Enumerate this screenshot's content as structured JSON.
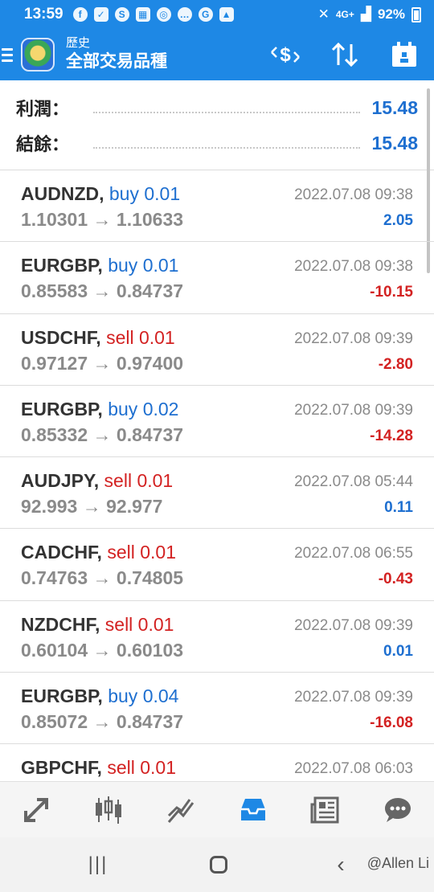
{
  "status_bar": {
    "time": "13:59",
    "icons": [
      "facebook-icon",
      "checkbox-icon",
      "app-icon",
      "calendar-icon",
      "fingerprint-icon",
      "chat-icon",
      "google-icon",
      "gallery-icon"
    ],
    "network": "4G+",
    "battery": "92%"
  },
  "toolbar": {
    "subtitle": "歷史",
    "title": "全部交易品種"
  },
  "summary": {
    "profit_label": "利潤：",
    "profit_value": "15.48",
    "balance_label": "結餘：",
    "balance_value": "15.48"
  },
  "deals": [
    {
      "symbol": "AUDNZD,",
      "direction": "buy 0.01",
      "side": "buy",
      "prices": "1.10301 → 1.10633",
      "datetime": "2022.07.08 09:38",
      "profit": "2.05",
      "profit_sign": "pos"
    },
    {
      "symbol": "EURGBP,",
      "direction": "buy 0.01",
      "side": "buy",
      "prices": "0.85583 → 0.84737",
      "datetime": "2022.07.08 09:38",
      "profit": "-10.15",
      "profit_sign": "neg"
    },
    {
      "symbol": "USDCHF,",
      "direction": "sell 0.01",
      "side": "sell",
      "prices": "0.97127 → 0.97400",
      "datetime": "2022.07.08 09:39",
      "profit": "-2.80",
      "profit_sign": "neg"
    },
    {
      "symbol": "EURGBP,",
      "direction": "buy 0.02",
      "side": "buy",
      "prices": "0.85332 → 0.84737",
      "datetime": "2022.07.08 09:39",
      "profit": "-14.28",
      "profit_sign": "neg"
    },
    {
      "symbol": "AUDJPY,",
      "direction": "sell 0.01",
      "side": "sell",
      "prices": "92.993 → 92.977",
      "datetime": "2022.07.08 05:44",
      "profit": "0.11",
      "profit_sign": "pos"
    },
    {
      "symbol": "CADCHF,",
      "direction": "sell 0.01",
      "side": "sell",
      "prices": "0.74763 → 0.74805",
      "datetime": "2022.07.08 06:55",
      "profit": "-0.43",
      "profit_sign": "neg"
    },
    {
      "symbol": "NZDCHF,",
      "direction": "sell 0.01",
      "side": "sell",
      "prices": "0.60104 → 0.60103",
      "datetime": "2022.07.08 09:39",
      "profit": "0.01",
      "profit_sign": "pos"
    },
    {
      "symbol": "EURGBP,",
      "direction": "buy 0.04",
      "side": "buy",
      "prices": "0.85072 → 0.84737",
      "datetime": "2022.07.08 09:39",
      "profit": "-16.08",
      "profit_sign": "neg"
    },
    {
      "symbol": "GBPCHF,",
      "direction": "sell 0.01",
      "side": "sell",
      "prices": "",
      "datetime": "2022.07.08 06:03",
      "profit": "",
      "profit_sign": "neg"
    }
  ],
  "bottom_nav": [
    "trade-icon",
    "quotes-icon",
    "chart-icon",
    "history-icon",
    "news-icon",
    "chat-icon"
  ],
  "bottom_nav_active": 3,
  "colors": {
    "primary": "#1e88e5",
    "buy": "#1e6fd0",
    "sell": "#d32222",
    "muted": "#8a8a8a"
  },
  "watermark": "@Allen Li"
}
